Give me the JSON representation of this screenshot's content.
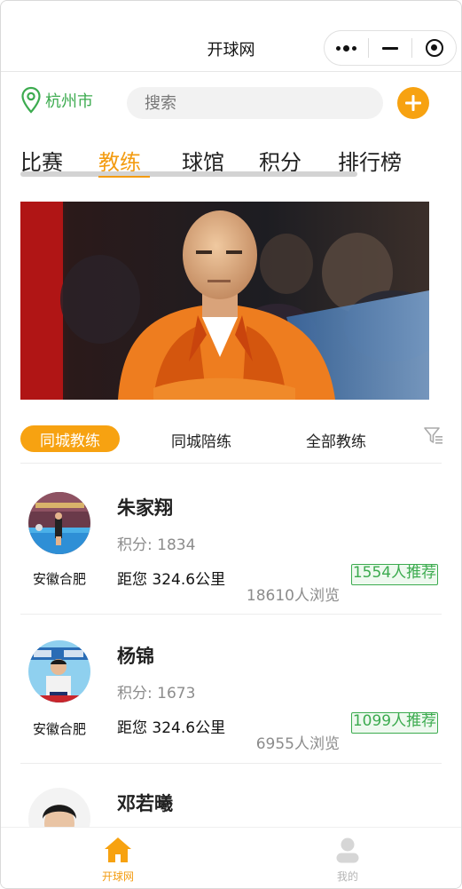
{
  "app": {
    "title": "开球网"
  },
  "location": {
    "city": "杭州市"
  },
  "search": {
    "placeholder": "搜索"
  },
  "tabs": [
    {
      "label": "比赛",
      "active": false
    },
    {
      "label": "教练",
      "active": true
    },
    {
      "label": "球馆",
      "active": false
    },
    {
      "label": "积分",
      "active": false
    },
    {
      "label": "排行榜",
      "active": false
    }
  ],
  "filters": [
    {
      "label": "同城教练",
      "active": true
    },
    {
      "label": "同城陪练",
      "active": false
    },
    {
      "label": "全部教练",
      "active": false
    }
  ],
  "coaches": [
    {
      "name": "朱家翔",
      "score": "积分: 1834",
      "region": "安徽合肥",
      "distance": "距您 324.6公里",
      "views": "18610人浏览",
      "recommend": "1554人推荐"
    },
    {
      "name": "杨锦",
      "score": "积分: 1673",
      "region": "安徽合肥",
      "distance": "距您 324.6公里",
      "views": "6955人浏览",
      "recommend": "1099人推荐"
    },
    {
      "name": "邓若曦"
    }
  ],
  "bottom_nav": [
    {
      "label": "开球网",
      "icon": "home-icon",
      "active": true
    },
    {
      "label": "我的",
      "icon": "user-icon",
      "active": false
    }
  ],
  "colors": {
    "accent": "#f39c12",
    "button": "#f7a211",
    "green": "#3cab4f"
  }
}
